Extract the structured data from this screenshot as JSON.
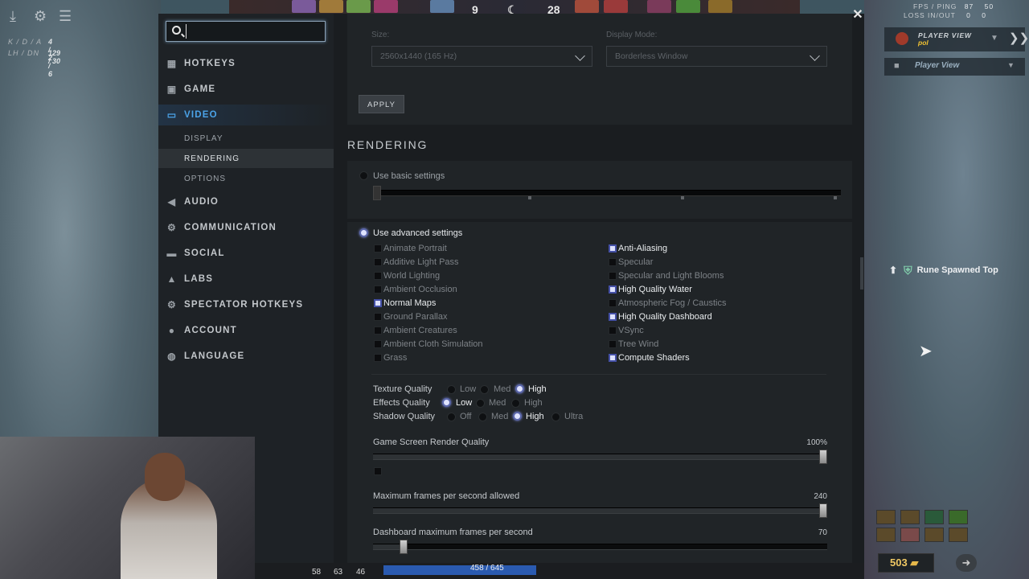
{
  "search": {
    "value": "",
    "placeholder": ""
  },
  "hud": {
    "kda_label": "K / D / A",
    "kda_value": "4 / 2 / 6",
    "lhdn_label": "LH / DN",
    "lhdn_value": "129 / 30",
    "score_left": "9",
    "score_right": "28",
    "fps_label": "FPS / PING",
    "fps_value": "87    50",
    "loss_label": "LOSS IN/OUT",
    "loss_value": "0    0",
    "player_view_title": "PLAYER VIEW",
    "player_view_sub": "pol",
    "player_view_select": "Player View",
    "notification": "Rune Spawned Top",
    "gold": "503",
    "bottom_stats": [
      "58",
      "63",
      "46"
    ],
    "hp": "458 / 645"
  },
  "nav": {
    "items": [
      {
        "label": "HOTKEYS",
        "icon": "grid-icon"
      },
      {
        "label": "GAME",
        "icon": "game-icon"
      },
      {
        "label": "VIDEO",
        "icon": "monitor-icon"
      },
      {
        "label": "AUDIO",
        "icon": "speaker-icon"
      },
      {
        "label": "COMMUNICATION",
        "icon": "gear-icon"
      },
      {
        "label": "SOCIAL",
        "icon": "chat-icon"
      },
      {
        "label": "LABS",
        "icon": "flask-icon"
      },
      {
        "label": "SPECTATOR HOTKEYS",
        "icon": "spectator-icon"
      },
      {
        "label": "ACCOUNT",
        "icon": "user-icon"
      },
      {
        "label": "LANGUAGE",
        "icon": "globe-icon"
      }
    ],
    "video_sub": [
      "DISPLAY",
      "RENDERING",
      "OPTIONS"
    ]
  },
  "display": {
    "size_label": "Size:",
    "size_value": "2560x1440 (165 Hz)",
    "mode_label": "Display Mode:",
    "mode_value": "Borderless Window",
    "apply": "APPLY"
  },
  "rendering": {
    "title": "RENDERING",
    "basic": "Use basic settings",
    "advanced": "Use advanced settings",
    "left_checks": [
      {
        "label": "Animate Portrait",
        "checked": false
      },
      {
        "label": "Additive Light Pass",
        "checked": false
      },
      {
        "label": "World Lighting",
        "checked": false
      },
      {
        "label": "Ambient Occlusion",
        "checked": false
      },
      {
        "label": "Normal Maps",
        "checked": true
      },
      {
        "label": "Ground Parallax",
        "checked": false
      },
      {
        "label": "Ambient Creatures",
        "checked": false
      },
      {
        "label": "Ambient Cloth Simulation",
        "checked": false
      },
      {
        "label": "Grass",
        "checked": false
      }
    ],
    "right_checks": [
      {
        "label": "Anti-Aliasing",
        "checked": true
      },
      {
        "label": "Specular",
        "checked": false
      },
      {
        "label": "Specular and Light Blooms",
        "checked": false
      },
      {
        "label": "High Quality Water",
        "checked": true
      },
      {
        "label": "Atmospheric Fog / Caustics",
        "checked": false
      },
      {
        "label": "High Quality Dashboard",
        "checked": true
      },
      {
        "label": "VSync",
        "checked": false
      },
      {
        "label": "Tree Wind",
        "checked": false
      },
      {
        "label": "Compute Shaders",
        "checked": true
      }
    ],
    "texture_label": "Texture Quality",
    "texture_opts": [
      "Low",
      "Med",
      "High"
    ],
    "effects_label": "Effects Quality",
    "effects_opts": [
      "Low",
      "Med",
      "High"
    ],
    "shadow_label": "Shadow Quality",
    "shadow_opts": [
      "Off",
      "Med",
      "High",
      "Ultra"
    ],
    "render_quality_label": "Game Screen Render Quality",
    "render_quality_value": "100%",
    "render_quality_level": 1.0,
    "max_fps_label": "Maximum frames per second allowed",
    "max_fps_value": "240",
    "max_fps_level": 1.0,
    "dash_fps_label": "Dashboard maximum frames per second",
    "dash_fps_value": "70",
    "dash_fps_level": 0.06
  }
}
